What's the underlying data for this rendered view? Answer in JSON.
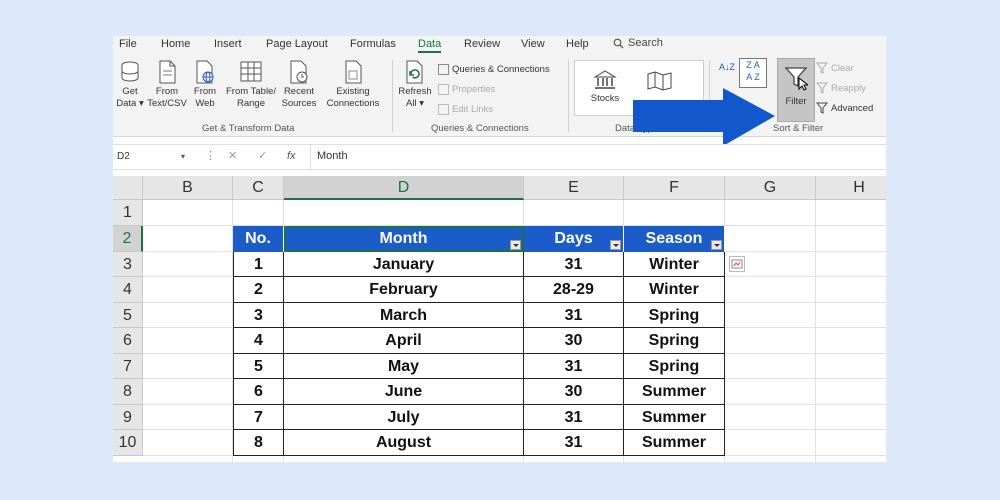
{
  "menu": {
    "items": [
      "File",
      "Home",
      "Insert",
      "Page Layout",
      "Formulas",
      "Data",
      "Review",
      "View",
      "Help"
    ],
    "active": "Data",
    "search_label": "Search"
  },
  "ribbon": {
    "get_transform": {
      "get_data_1": "Get",
      "get_data_2": "Data",
      "from_textcsv_1": "From",
      "from_textcsv_2": "Text/CSV",
      "from_web_1": "From",
      "from_web_2": "Web",
      "from_table_1": "From Table/",
      "from_table_2": "Range",
      "recent_sources_1": "Recent",
      "recent_sources_2": "Sources",
      "existing_conn_1": "Existing",
      "existing_conn_2": "Connections",
      "group_label": "Get & Transform Data"
    },
    "queries": {
      "refresh_all_1": "Refresh",
      "refresh_all_2": "All",
      "queries_connections": "Queries & Connections",
      "properties": "Properties",
      "edit_links": "Edit Links",
      "group_label": "Queries & Connections"
    },
    "data_types": {
      "stocks": "Stocks",
      "group_label": "Data Types"
    },
    "sort_filter": {
      "filter": "Filter",
      "clear": "Clear",
      "reapply": "Reapply",
      "advanced": "Advanced",
      "group_label": "Sort & Filter"
    }
  },
  "formula_bar": {
    "name_box": "D2",
    "value": "Month"
  },
  "grid": {
    "columns": [
      "B",
      "C",
      "D",
      "E",
      "F",
      "G",
      "H"
    ],
    "rows": [
      "1",
      "2",
      "3",
      "4",
      "5",
      "6",
      "7",
      "8",
      "9",
      "10"
    ],
    "selected_column": "D",
    "selected_row": "2"
  },
  "table": {
    "headers": [
      "No.",
      "Month",
      "Days",
      "Season"
    ],
    "rows": [
      [
        "1",
        "January",
        "31",
        "Winter"
      ],
      [
        "2",
        "February",
        "28-29",
        "Winter"
      ],
      [
        "3",
        "March",
        "31",
        "Spring"
      ],
      [
        "4",
        "April",
        "30",
        "Spring"
      ],
      [
        "5",
        "May",
        "31",
        "Spring"
      ],
      [
        "6",
        "June",
        "30",
        "Summer"
      ],
      [
        "7",
        "July",
        "31",
        "Summer"
      ],
      [
        "8",
        "August",
        "31",
        "Summer"
      ]
    ]
  },
  "colors": {
    "table_header_bg": "#1b5cc8",
    "excel_green": "#1e7145",
    "arrow": "#1258cc"
  }
}
